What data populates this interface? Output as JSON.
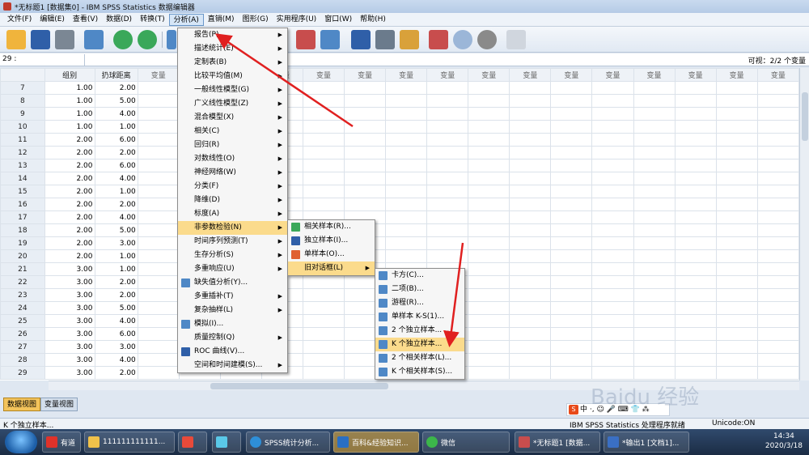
{
  "window": {
    "title": "*无标题1 [数据集0] - IBM SPSS Statistics 数据编辑器"
  },
  "menubar": [
    "文件(F)",
    "编辑(E)",
    "查看(V)",
    "数据(D)",
    "转换(T)",
    "分析(A)",
    "直销(M)",
    "图形(G)",
    "实用程序(U)",
    "窗口(W)",
    "帮助(H)"
  ],
  "refbar": {
    "cell": "29 :",
    "visible": "可视：2/2 个变量"
  },
  "grid": {
    "headers": [
      "组别",
      "扔球距离",
      "变量",
      "变量",
      "变量",
      "变量",
      "变量",
      "变量",
      "变量",
      "变量",
      "变量",
      "变量",
      "变量",
      "变量",
      "变量",
      "变量",
      "变量",
      "变量"
    ],
    "rows": [
      [
        "7",
        "1.00",
        "2.00"
      ],
      [
        "8",
        "1.00",
        "5.00"
      ],
      [
        "9",
        "1.00",
        "4.00"
      ],
      [
        "10",
        "1.00",
        "1.00"
      ],
      [
        "11",
        "2.00",
        "6.00"
      ],
      [
        "12",
        "2.00",
        "2.00"
      ],
      [
        "13",
        "2.00",
        "6.00"
      ],
      [
        "14",
        "2.00",
        "4.00"
      ],
      [
        "15",
        "2.00",
        "1.00"
      ],
      [
        "16",
        "2.00",
        "2.00"
      ],
      [
        "17",
        "2.00",
        "4.00"
      ],
      [
        "18",
        "2.00",
        "5.00"
      ],
      [
        "19",
        "2.00",
        "3.00"
      ],
      [
        "20",
        "2.00",
        "1.00"
      ],
      [
        "21",
        "3.00",
        "1.00"
      ],
      [
        "22",
        "3.00",
        "2.00"
      ],
      [
        "23",
        "3.00",
        "2.00"
      ],
      [
        "24",
        "3.00",
        "5.00"
      ],
      [
        "25",
        "3.00",
        "4.00"
      ],
      [
        "26",
        "3.00",
        "6.00"
      ],
      [
        "27",
        "3.00",
        "3.00"
      ],
      [
        "28",
        "3.00",
        "4.00"
      ],
      [
        "29",
        "3.00",
        "2.00"
      ]
    ]
  },
  "analyze_menu": [
    {
      "label": "报告(P)",
      "sub": true
    },
    {
      "label": "描述统计(E)",
      "sub": true
    },
    {
      "label": "定制表(B)",
      "sub": true
    },
    {
      "label": "比较平均值(M)",
      "sub": true
    },
    {
      "label": "一般线性模型(G)",
      "sub": true
    },
    {
      "label": "广义线性模型(Z)",
      "sub": true
    },
    {
      "label": "混合模型(X)",
      "sub": true
    },
    {
      "label": "相关(C)",
      "sub": true
    },
    {
      "label": "回归(R)",
      "sub": true
    },
    {
      "label": "对数线性(O)",
      "sub": true
    },
    {
      "label": "神经网络(W)",
      "sub": true
    },
    {
      "label": "分类(F)",
      "sub": true
    },
    {
      "label": "降维(D)",
      "sub": true
    },
    {
      "label": "标度(A)",
      "sub": true
    },
    {
      "label": "非参数检验(N)",
      "sub": true,
      "hl": true
    },
    {
      "label": "时间序列预测(T)",
      "sub": true
    },
    {
      "label": "生存分析(S)",
      "sub": true
    },
    {
      "label": "多重响应(U)",
      "sub": true
    },
    {
      "label": "缺失值分析(Y)...",
      "sub": false,
      "icon": "missing-value-icon"
    },
    {
      "label": "多重插补(T)",
      "sub": true
    },
    {
      "label": "复杂抽样(L)",
      "sub": true
    },
    {
      "label": "模拟(I)...",
      "sub": false,
      "icon": "simulation-icon"
    },
    {
      "label": "质量控制(Q)",
      "sub": true
    },
    {
      "label": "ROC 曲线(V)...",
      "sub": false,
      "icon": "roc-icon"
    },
    {
      "label": "空间和时间建模(S)...",
      "sub": true
    }
  ],
  "nonparam_menu": [
    {
      "label": "相关样本(R)...",
      "icon": "related-samples-icon"
    },
    {
      "label": "独立样本(I)...",
      "icon": "independent-samples-icon"
    },
    {
      "label": "单样本(O)...",
      "icon": "one-sample-icon"
    },
    {
      "label": "旧对话框(L)",
      "sub": true,
      "hl": true
    }
  ],
  "legacy_menu": [
    {
      "label": "卡方(C)..."
    },
    {
      "label": "二项(B)..."
    },
    {
      "label": "游程(R)..."
    },
    {
      "label": "单样本 K-S(1)..."
    },
    {
      "label": "2 个独立样本..."
    },
    {
      "label": "K 个独立样本...",
      "hl": true
    },
    {
      "label": "2 个相关样本(L)..."
    },
    {
      "label": "K 个相关样本(S)..."
    }
  ],
  "tabs": {
    "data_view": "数据视图",
    "variable_view": "变量视图"
  },
  "status": {
    "message": "K 个独立样本...",
    "processor": "IBM SPSS Statistics 处理程序就绪",
    "unicode": "Unicode:ON"
  },
  "ime": {
    "text": "中 ·, ☺ 🎤 ⌨ 👕 ⁂"
  },
  "watermark": "Baidu 经验",
  "taskbar": {
    "items": [
      "有道",
      "111111111111...",
      "",
      "",
      "SPSS统计分析...",
      "百科&经验知识...",
      "微信",
      "*无标题1 [数据...",
      "*输出1 [文档1]..."
    ],
    "time": "14:34",
    "date": "2020/3/18"
  },
  "colors": {
    "menu_highlight": "#fbdb8c",
    "active_tab": "#f3c35b",
    "arrow": "#e02020"
  }
}
